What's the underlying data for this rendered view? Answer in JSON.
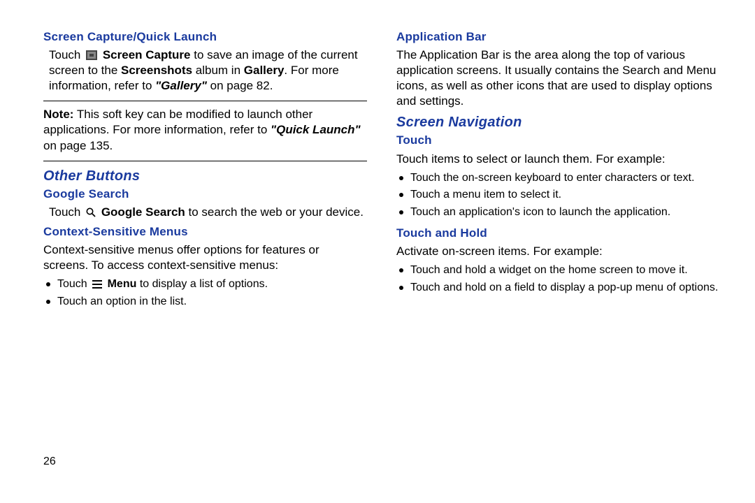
{
  "left": {
    "h1": "Screen Capture/Quick Launch",
    "p1_a": "Touch ",
    "p1_b": "Screen Capture",
    "p1_c": " to save an image of the current screen to the ",
    "p1_d": "Screenshots",
    "p1_e": " album in ",
    "p1_f": "Gallery",
    "p1_g": ". For more information, refer to ",
    "p1_h": "\"Gallery\"",
    "p1_i": "  on page 82.",
    "note_label": "Note:",
    "note_a": " This soft key can be modified to launch other applications. For more information, refer to ",
    "note_b": "\"Quick Launch\"",
    "note_c": "  on page 135.",
    "h2": "Other Buttons",
    "h3": "Google Search",
    "p2_a": "Touch ",
    "p2_b": "Google Search",
    "p2_c": " to search the web or your device.",
    "h4": "Context-Sensitive Menus",
    "p3": "Context-sensitive menus offer options for features or screens. To access context-sensitive menus:",
    "b1_a": "Touch ",
    "b1_b": "Menu",
    "b1_c": " to display a list of options.",
    "b2": "Touch an option in the list."
  },
  "right": {
    "h1": "Application Bar",
    "p1": "The Application Bar is the area along the top of various application screens. It usually contains the Search and Menu icons, as well as other icons that are used to display options and settings.",
    "h2": "Screen Navigation",
    "h3": "Touch",
    "p2": "Touch items to select or launch them. For example:",
    "b1": "Touch the on-screen keyboard to enter characters or text.",
    "b2": "Touch a menu item to select it.",
    "b3": "Touch an application's icon to launch the application.",
    "h4": "Touch and Hold",
    "p3": "Activate on-screen items. For example:",
    "b4": "Touch and hold a widget on the home screen to move it.",
    "b5": "Touch and hold on a field to display a pop-up menu of options."
  },
  "page_number": "26"
}
